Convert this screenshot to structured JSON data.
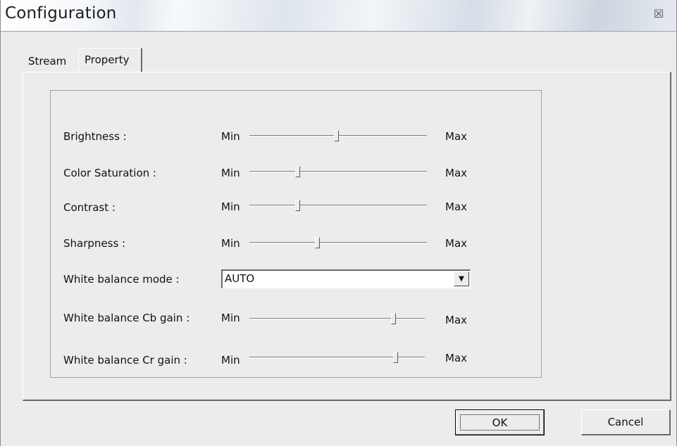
{
  "window": {
    "title": "Configuration",
    "close_glyph": "☒"
  },
  "tabs": [
    {
      "label": "Stream",
      "selected": false
    },
    {
      "label": "Property",
      "selected": true
    }
  ],
  "properties": {
    "min_label": "Min",
    "max_label": "Max",
    "brightness": {
      "label": "Brightness :",
      "value_fraction": 0.49
    },
    "color_saturation": {
      "label": "Color Saturation :",
      "value_fraction": 0.27
    },
    "contrast": {
      "label": "Contrast :",
      "value_fraction": 0.27
    },
    "sharpness": {
      "label": "Sharpness :",
      "value_fraction": 0.38
    },
    "white_balance_mode": {
      "label": "White balance mode :",
      "value": "AUTO"
    },
    "wb_cb_gain": {
      "label": "White balance Cb gain :",
      "value_fraction": 0.82
    },
    "wb_cr_gain": {
      "label": "White balance Cr gain :",
      "value_fraction": 0.83
    }
  },
  "buttons": {
    "ok_label": "OK",
    "cancel_label": "Cancel"
  },
  "icons": {
    "close": "close-icon",
    "dropdown": "chevron-down-icon"
  }
}
